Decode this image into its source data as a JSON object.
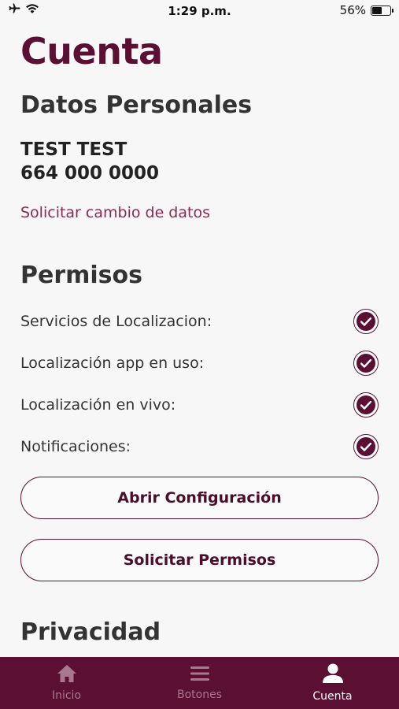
{
  "status_bar": {
    "time": "1:29 p.m.",
    "battery_percent": "56%",
    "battery_level": 0.56
  },
  "page": {
    "title": "Cuenta"
  },
  "personal": {
    "heading": "Datos Personales",
    "name": "TEST TEST",
    "phone": "664 000 0000",
    "change_link": "Solicitar cambio de datos"
  },
  "permissions": {
    "heading": "Permisos",
    "items": [
      {
        "label": "Servicios de Localizacion:",
        "checked": true
      },
      {
        "label": "Localización app en uso:",
        "checked": true
      },
      {
        "label": "Localización en vivo:",
        "checked": true
      },
      {
        "label": "Notificaciones:",
        "checked": true
      }
    ],
    "open_settings_label": "Abrir Configuración",
    "request_permissions_label": "Solicitar Permisos"
  },
  "privacy": {
    "heading": "Privacidad"
  },
  "tabs": [
    {
      "label": "Inicio",
      "icon": "home-icon",
      "active": false
    },
    {
      "label": "Botones",
      "icon": "menu-icon",
      "active": false
    },
    {
      "label": "Cuenta",
      "icon": "user-icon",
      "active": true
    }
  ],
  "colors": {
    "brand": "#5a0f33",
    "link": "#8a2a55",
    "tab_inactive": "#a9788f"
  }
}
